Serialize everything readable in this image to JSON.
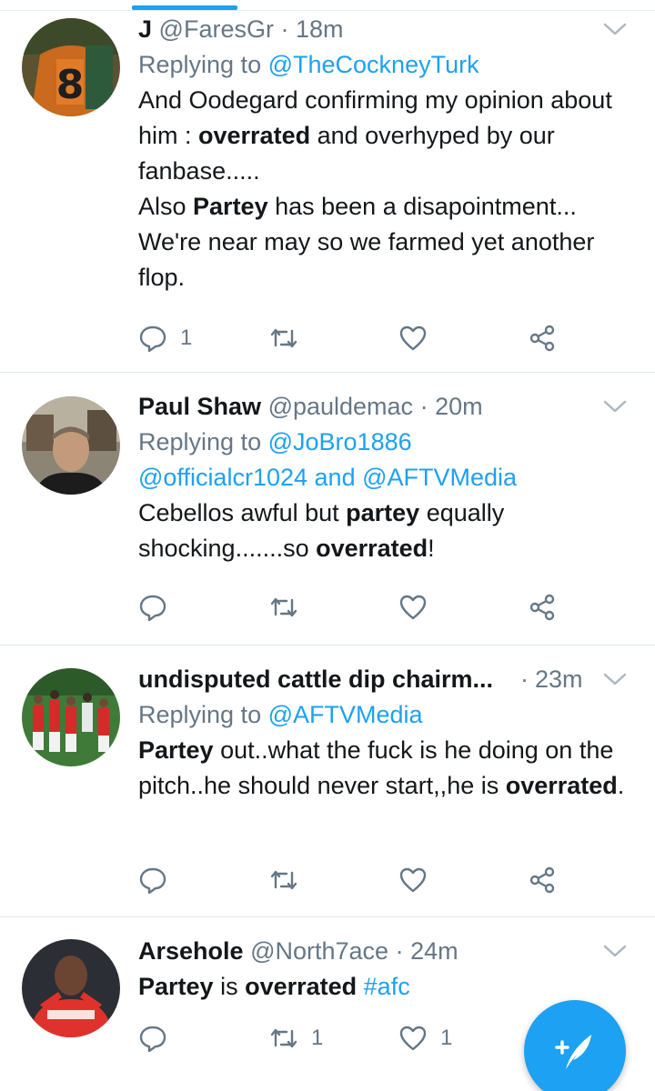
{
  "tweets": [
    {
      "name": "J",
      "handle": "@FaresGr",
      "dot": "·",
      "time": "18m",
      "replying_prefix": "Replying to",
      "replying_mentions": "@TheCockneyTurk",
      "text_parts": [
        {
          "t": "And Oodegard confirming my opinion about him : ",
          "b": false
        },
        {
          "t": "overrated",
          "b": true
        },
        {
          "t": " and overhyped by our fanbase.....",
          "b": false
        },
        {
          "t": "Also ",
          "b": false,
          "br": true
        },
        {
          "t": "Partey",
          "b": true
        },
        {
          "t": " has been a disapointment... We're near may so we farmed yet another flop.",
          "b": false
        }
      ],
      "reply_count": "1",
      "retweet_count": "",
      "like_count": ""
    },
    {
      "name": "Paul Shaw",
      "handle": "@pauldemac",
      "dot": "·",
      "time": "20m",
      "replying_prefix": "Replying to",
      "replying_mentions_line1": "@JoBro1886",
      "replying_mentions_line2a": "@officialcr1024",
      "replying_and": "and",
      "replying_mentions_line2b": "@AFTVMedia",
      "text_parts": [
        {
          "t": "Cebellos awful but ",
          "b": false
        },
        {
          "t": "partey",
          "b": true
        },
        {
          "t": " equally shocking.......so ",
          "b": false
        },
        {
          "t": "overrated",
          "b": true
        },
        {
          "t": "!",
          "b": false
        }
      ],
      "reply_count": "",
      "retweet_count": "",
      "like_count": ""
    },
    {
      "name": "undisputed cattle dip chairm...",
      "handle": "",
      "dot": "·",
      "time": "23m",
      "replying_prefix": "Replying to",
      "replying_mentions": "@AFTVMedia",
      "text_parts": [
        {
          "t": "Partey",
          "b": true
        },
        {
          "t": " out..what the fuck is he doing on the pitch..he should never start,,he is ",
          "b": false
        },
        {
          "t": "overrated",
          "b": true
        },
        {
          "t": ".",
          "b": false
        }
      ],
      "reply_count": "",
      "retweet_count": "",
      "like_count": ""
    },
    {
      "name": "Arsehole",
      "handle": "@North7ace",
      "dot": "·",
      "time": "24m",
      "text_parts": [
        {
          "t": "Partey",
          "b": true
        },
        {
          "t": " is ",
          "b": false
        },
        {
          "t": "overrated",
          "b": true
        },
        {
          "t": " ",
          "b": false
        },
        {
          "t": "#afc",
          "b": false,
          "hashtag": true
        }
      ],
      "reply_count": "",
      "retweet_count": "1",
      "like_count": "1"
    }
  ],
  "icons": {
    "reply": "reply-icon",
    "retweet": "retweet-icon",
    "like": "heart-icon",
    "share": "share-icon",
    "caret": "chevron-down-icon",
    "compose": "compose-tweet-icon"
  },
  "colors": {
    "accent": "#1da1f2",
    "secondary_text": "#657786",
    "primary_text": "#14171a",
    "divider": "#e1e8ed"
  }
}
